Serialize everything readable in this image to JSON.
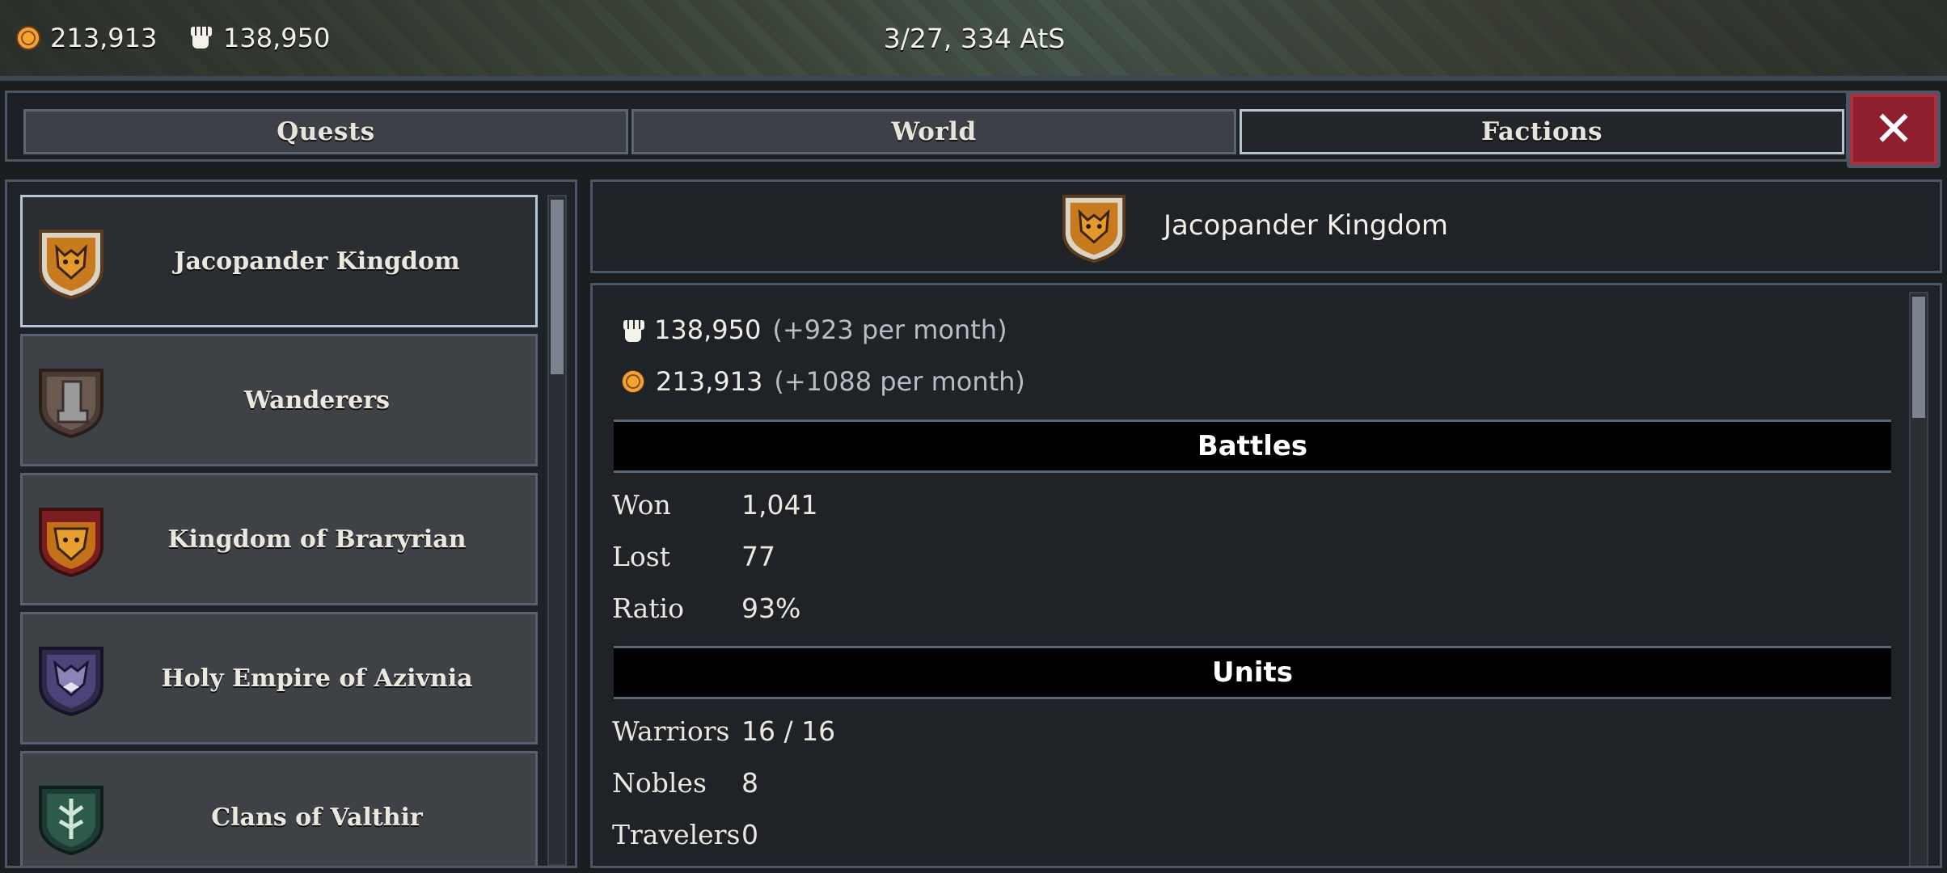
{
  "hud": {
    "gold": "213,913",
    "power": "138,950",
    "date": "3/27, 334 AtS"
  },
  "tabs": [
    {
      "label": "Quests",
      "active": false
    },
    {
      "label": "World",
      "active": false
    },
    {
      "label": "Factions",
      "active": true
    }
  ],
  "close_label": "✕",
  "factions": [
    {
      "name": "Jacopander Kingdom",
      "icon": "tiger-shield-icon",
      "selected": true
    },
    {
      "name": "Wanderers",
      "icon": "boot-shield-icon",
      "selected": false
    },
    {
      "name": "Kingdom of Braryrian",
      "icon": "lion-shield-icon",
      "selected": false
    },
    {
      "name": "Holy Empire of Azivnia",
      "icon": "wolf-shield-icon",
      "selected": false
    },
    {
      "name": "Clans of Valthir",
      "icon": "tree-shield-icon",
      "selected": false
    }
  ],
  "detail": {
    "title": "Jacopander Kingdom",
    "power_value": "138,950",
    "power_rate": "(+923 per month)",
    "gold_value": "213,913",
    "gold_rate": "(+1088 per month)",
    "battles_heading": "Battles",
    "battles": [
      {
        "label": "Won",
        "value": "1,041"
      },
      {
        "label": "Lost",
        "value": "77"
      },
      {
        "label": "Ratio",
        "value": "93%"
      }
    ],
    "units_heading": "Units",
    "units": [
      {
        "label": "Warriors",
        "value": "16 / 16"
      },
      {
        "label": "Nobles",
        "value": "8"
      },
      {
        "label": "Travelers",
        "value": "0"
      }
    ]
  },
  "colors": {
    "accent_red": "#8e1f2e",
    "panel_border": "#4a5866",
    "gold": "#f4a52c"
  }
}
